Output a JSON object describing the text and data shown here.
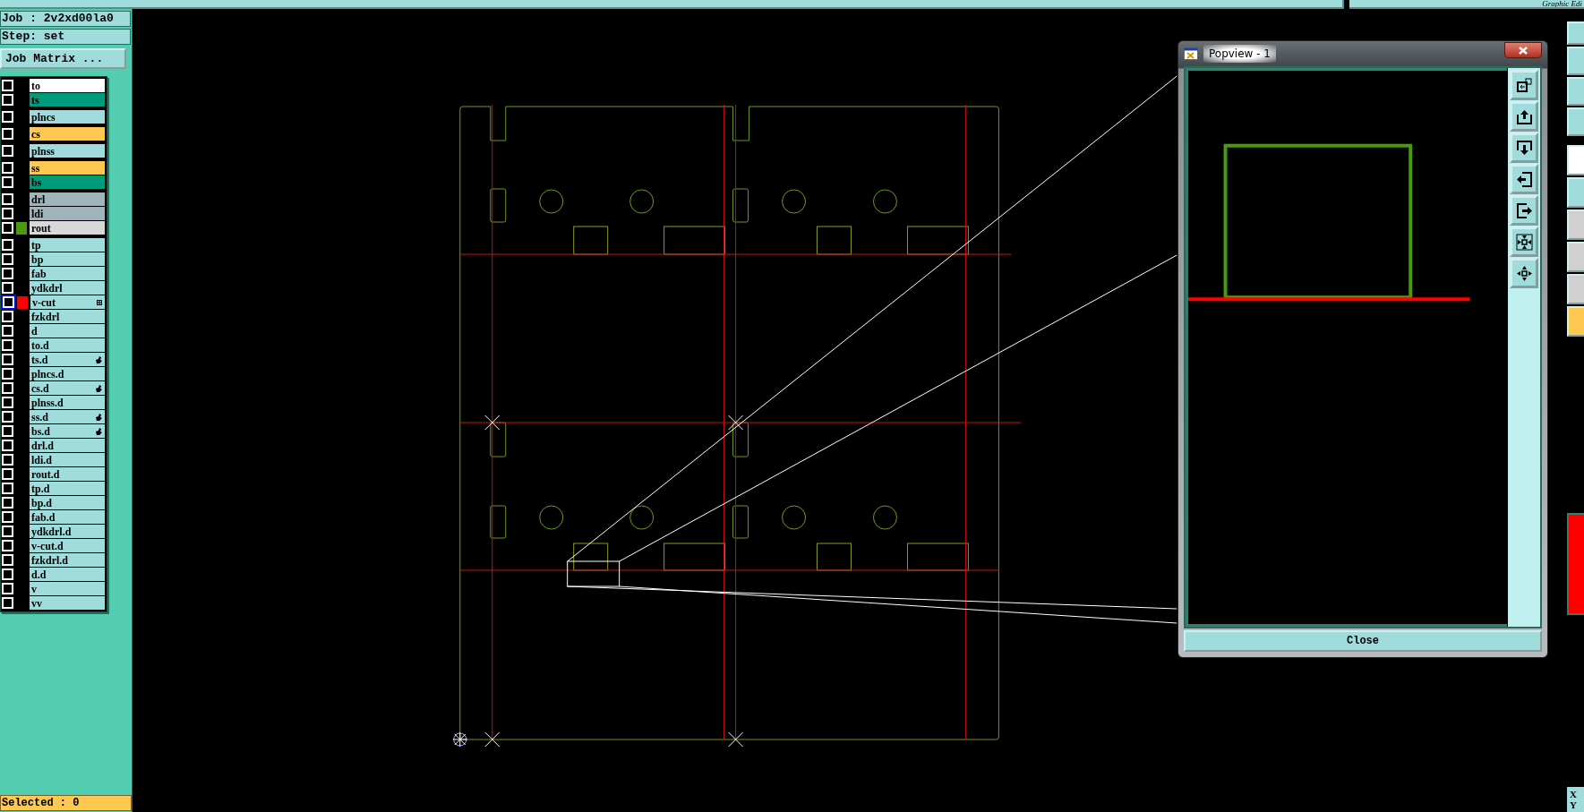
{
  "top_bar": {
    "title": "Graphic Edi"
  },
  "job": "Job : 2v2xd00la0",
  "step": "Step: set",
  "job_matrix_button": "Job Matrix ...",
  "layer_groups": [
    {
      "layers": [
        {
          "name": "to",
          "kind": "silk",
          "checked": false,
          "current": false,
          "linked": false,
          "boxed": false
        },
        {
          "name": "ts",
          "kind": "mask",
          "checked": false,
          "current": false,
          "linked": false,
          "boxed": false
        }
      ]
    },
    {
      "layers": [
        {
          "name": "plncs",
          "kind": "document",
          "checked": false,
          "current": false,
          "linked": false,
          "boxed": false
        }
      ]
    },
    {
      "layers": [
        {
          "name": "cs",
          "kind": "signal",
          "checked": false,
          "current": false,
          "linked": false,
          "boxed": false
        }
      ]
    },
    {
      "layers": [
        {
          "name": "plnss",
          "kind": "document",
          "checked": false,
          "current": false,
          "linked": false,
          "boxed": false
        }
      ]
    },
    {
      "layers": [
        {
          "name": "ss",
          "kind": "signal",
          "checked": false,
          "current": false,
          "linked": false,
          "boxed": false
        },
        {
          "name": "bs",
          "kind": "mask",
          "checked": false,
          "current": false,
          "linked": false,
          "boxed": false
        }
      ]
    },
    {
      "layers": [
        {
          "name": "drl",
          "kind": "drill",
          "checked": false,
          "current": false,
          "linked": false,
          "boxed": false
        },
        {
          "name": "ldi",
          "kind": "drill",
          "checked": false,
          "current": false,
          "linked": false,
          "boxed": false
        },
        {
          "name": "rout",
          "kind": "rout",
          "checked": false,
          "current": false,
          "linked": false,
          "boxed": false,
          "color": "#4a9a10"
        }
      ]
    },
    {
      "layers": [
        {
          "name": "tp",
          "kind": "document",
          "checked": false,
          "current": false,
          "linked": false,
          "boxed": false
        },
        {
          "name": "bp",
          "kind": "document",
          "checked": false,
          "current": false,
          "linked": false,
          "boxed": false
        },
        {
          "name": "fab",
          "kind": "document",
          "checked": false,
          "current": false,
          "linked": false,
          "boxed": false
        },
        {
          "name": "ydkdrl",
          "kind": "document",
          "checked": false,
          "current": false,
          "linked": false,
          "boxed": false
        },
        {
          "name": "v-cut",
          "kind": "document",
          "checked": false,
          "current": true,
          "linked": false,
          "boxed": true,
          "color": "#ff0000"
        },
        {
          "name": "fzkdrl",
          "kind": "document",
          "checked": false,
          "current": false,
          "linked": false,
          "boxed": false
        },
        {
          "name": "d",
          "kind": "document",
          "checked": false,
          "current": false,
          "linked": false,
          "boxed": false
        },
        {
          "name": "to.d",
          "kind": "document",
          "checked": false,
          "current": false,
          "linked": false,
          "boxed": false
        },
        {
          "name": "ts.d",
          "kind": "document",
          "checked": false,
          "current": false,
          "linked": true,
          "boxed": false
        },
        {
          "name": "plncs.d",
          "kind": "document",
          "checked": false,
          "current": false,
          "linked": false,
          "boxed": false
        },
        {
          "name": "cs.d",
          "kind": "document",
          "checked": false,
          "current": false,
          "linked": true,
          "boxed": false
        },
        {
          "name": "plnss.d",
          "kind": "document",
          "checked": false,
          "current": false,
          "linked": false,
          "boxed": false
        },
        {
          "name": "ss.d",
          "kind": "document",
          "checked": false,
          "current": false,
          "linked": true,
          "boxed": false
        },
        {
          "name": "bs.d",
          "kind": "document",
          "checked": false,
          "current": false,
          "linked": true,
          "boxed": false
        },
        {
          "name": "drl.d",
          "kind": "document",
          "checked": false,
          "current": false,
          "linked": false,
          "boxed": false
        },
        {
          "name": "ldi.d",
          "kind": "document",
          "checked": false,
          "current": false,
          "linked": false,
          "boxed": false
        },
        {
          "name": "rout.d",
          "kind": "document",
          "checked": false,
          "current": false,
          "linked": false,
          "boxed": false
        },
        {
          "name": "tp.d",
          "kind": "document",
          "checked": false,
          "current": false,
          "linked": false,
          "boxed": false
        },
        {
          "name": "bp.d",
          "kind": "document",
          "checked": false,
          "current": false,
          "linked": false,
          "boxed": false
        },
        {
          "name": "fab.d",
          "kind": "document",
          "checked": false,
          "current": false,
          "linked": false,
          "boxed": false
        },
        {
          "name": "ydkdrl.d",
          "kind": "document",
          "checked": false,
          "current": false,
          "linked": false,
          "boxed": false
        },
        {
          "name": "v-cut.d",
          "kind": "document",
          "checked": false,
          "current": false,
          "linked": false,
          "boxed": false
        },
        {
          "name": "fzkdrl.d",
          "kind": "document",
          "checked": false,
          "current": false,
          "linked": false,
          "boxed": false
        },
        {
          "name": "d.d",
          "kind": "document",
          "checked": false,
          "current": false,
          "linked": false,
          "boxed": false
        },
        {
          "name": "v",
          "kind": "document",
          "checked": false,
          "current": false,
          "linked": false,
          "boxed": false
        },
        {
          "name": "vv",
          "kind": "document",
          "checked": false,
          "current": false,
          "linked": false,
          "boxed": false
        }
      ]
    }
  ],
  "status": "Selected : 0",
  "popview": {
    "title": "Popview - 1",
    "close_button": "Close"
  },
  "coordinates": {
    "x_label": "X",
    "y_label": "Y"
  }
}
